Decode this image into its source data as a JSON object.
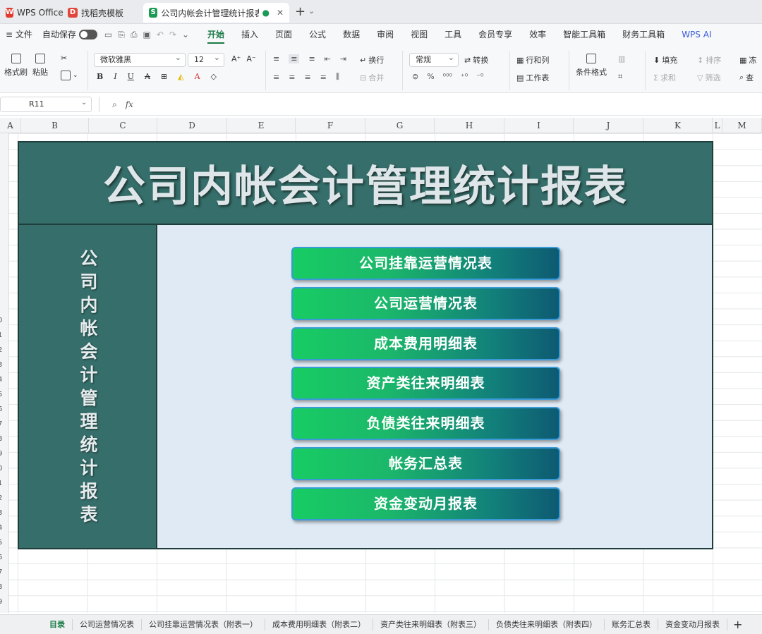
{
  "tabs": [
    {
      "label": "WPS Office",
      "logo": "W"
    },
    {
      "label": "找稻壳模板",
      "logo": "D"
    },
    {
      "label": "公司内帐会计管理统计报表.xl",
      "logo": "S",
      "active": true
    }
  ],
  "menu": {
    "file": "文件",
    "autosave": "自动保存",
    "items": [
      "开始",
      "插入",
      "页面",
      "公式",
      "数据",
      "审阅",
      "视图",
      "工具",
      "会员专享",
      "效率",
      "智能工具箱",
      "财务工具箱",
      "WPS AI"
    ]
  },
  "ribbon": {
    "format_painter": "格式刷",
    "paste": "粘贴",
    "font_name": "微软雅黑",
    "font_size": "12",
    "wrap": "换行",
    "merge": "合并",
    "number_format": "常规",
    "convert": "转换",
    "row_col": "行和列",
    "worksheet": "工作表",
    "conditional_format": "条件格式",
    "fill": "填充",
    "sort": "排序",
    "sum": "求和",
    "filter": "筛选",
    "freeze": "冻",
    "find": "查"
  },
  "formula_bar": {
    "cell_ref": "R11",
    "fx": "fx"
  },
  "columns": [
    "A",
    "B",
    "C",
    "D",
    "E",
    "F",
    "G",
    "H",
    "I",
    "J",
    "K",
    "L",
    "M"
  ],
  "rows": [
    "0",
    "1",
    "2",
    "3",
    "4",
    "5",
    "6",
    "7",
    "8",
    "9",
    "0",
    "1",
    "2",
    "3",
    "4",
    "5",
    "6",
    "7",
    "8",
    "9"
  ],
  "dashboard": {
    "title": "公司内帐会计管理统计报表",
    "side_title": "公司内帐会计管理统计报表",
    "buttons": [
      "公司挂靠运营情况表",
      "公司运营情况表",
      "成本费用明细表",
      "资产类往来明细表",
      "负债类往来明细表",
      "帐务汇总表",
      "资金变动月报表"
    ]
  },
  "sheet_tabs": [
    "目录",
    "公司运营情况表",
    "公司挂靠运营情况表（附表一）",
    "成本费用明细表（附表二）",
    "资产类往来明细表（附表三）",
    "负债类往来明细表（附表四）",
    "账务汇总表",
    "资金变动月报表"
  ],
  "add_sheet": "+",
  "colors": {
    "header_bg": "#356e6a",
    "body_bg": "#dfeaf4",
    "btn_start": "#17cc63",
    "btn_end": "#0e5a72"
  }
}
